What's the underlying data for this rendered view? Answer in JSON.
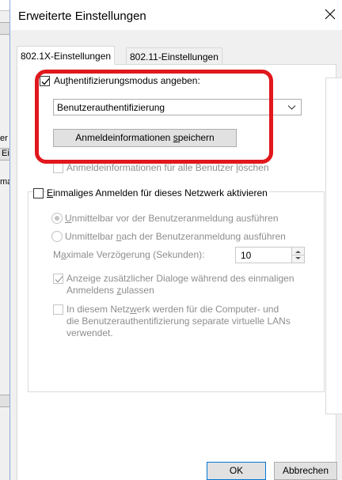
{
  "background": {
    "fragments": [
      {
        "text": "er"
      },
      {
        "text": "Ei"
      },
      {
        "text": "ma"
      }
    ]
  },
  "dialog": {
    "title": "Erweiterte Einstellungen",
    "close_glyph": "✕",
    "tabs": [
      {
        "label": "802.1X-Einstellungen",
        "active": true
      },
      {
        "label": "802.11-Einstellungen",
        "active": false
      }
    ],
    "auth_mode": {
      "checkbox_checked": true,
      "label_pre": "Au",
      "label_acc": "t",
      "label_post": "hentifizierungsmodus angeben:",
      "select_value": "Benutzerauthentifizierung",
      "save_btn_pre": "Anmeldeinformationen ",
      "save_btn_acc": "s",
      "save_btn_post": "peichern",
      "delete_label_pre": "Anmeldeinformationen für alle Benutzer ",
      "delete_label_acc": "l",
      "delete_label_post": "öschen"
    },
    "sso": {
      "label_acc": "E",
      "label_post": "inmaliges Anmelden für dieses Netzwerk aktivieren",
      "radio1_acc": "U",
      "radio1_post": "nmittelbar vor der Benutzeranmeldung ausführen",
      "radio2_pre": "Unmittelbar ",
      "radio2_acc": "n",
      "radio2_post": "ach der Benutzeranmeldung ausführen",
      "delay_pre": "M",
      "delay_acc": "a",
      "delay_post": "ximale Verzögerung (Sekunden):",
      "delay_value": "10",
      "dialogs_line1": "Anzeige zusätzlicher Dialoge während des einmaligen",
      "dialogs_line2_pre": "Anmeldens ",
      "dialogs_line2_acc": "z",
      "dialogs_line2_post": "ulassen",
      "vlan_line1_pre": "In diesem Netz",
      "vlan_line1_acc": "w",
      "vlan_line1_post": "erk werden für die Computer- und",
      "vlan_line2": "die Benutzerauthentifizierung separate virtuelle LANs",
      "vlan_line3": "verwendet."
    },
    "buttons": {
      "ok": "OK",
      "cancel": "Abbrechen"
    }
  },
  "colors": {
    "highlight": "#e0171c",
    "accent": "#0078d7"
  }
}
